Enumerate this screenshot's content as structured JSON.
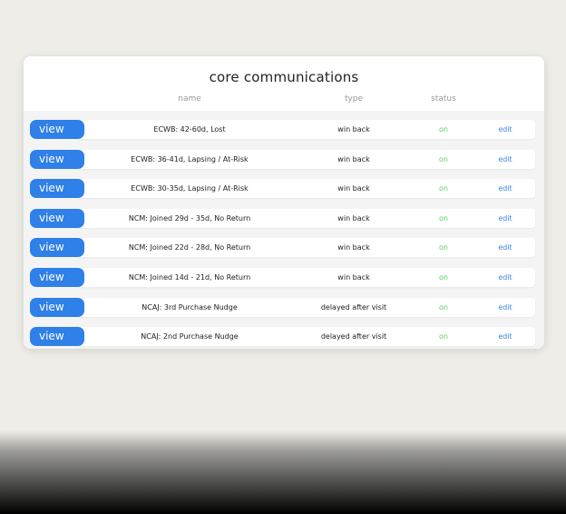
{
  "card": {
    "title": "core communications",
    "columns": {
      "name": "name",
      "type": "type",
      "status": "status"
    }
  },
  "rows": [
    {
      "view": "view",
      "name": "ECWB: 42-60d, Lost",
      "type": "win back",
      "status": "on",
      "edit": "edit"
    },
    {
      "view": "view",
      "name": "ECWB: 36-41d, Lapsing / At-Risk",
      "type": "win back",
      "status": "on",
      "edit": "edit"
    },
    {
      "view": "view",
      "name": "ECWB: 30-35d, Lapsing / At-Risk",
      "type": "win back",
      "status": "on",
      "edit": "edit"
    },
    {
      "view": "view",
      "name": "NCM: Joined 29d - 35d, No Return",
      "type": "win back",
      "status": "on",
      "edit": "edit"
    },
    {
      "view": "view",
      "name": "NCM: Joined 22d - 28d, No Return",
      "type": "win back",
      "status": "on",
      "edit": "edit"
    },
    {
      "view": "view",
      "name": "NCM: Joined 14d - 21d, No Return",
      "type": "win back",
      "status": "on",
      "edit": "edit"
    },
    {
      "view": "view",
      "name": "NCAJ: 3rd Purchase Nudge",
      "type": "delayed after visit",
      "status": "on",
      "edit": "edit"
    },
    {
      "view": "view",
      "name": "NCAJ: 2nd Purchase Nudge",
      "type": "delayed after visit",
      "status": "on",
      "edit": "edit"
    }
  ],
  "colors": {
    "background": "#eeede7",
    "view_button": "#2f80e8",
    "status_on": "#5ccf5f",
    "edit_link": "#3a86e8"
  }
}
